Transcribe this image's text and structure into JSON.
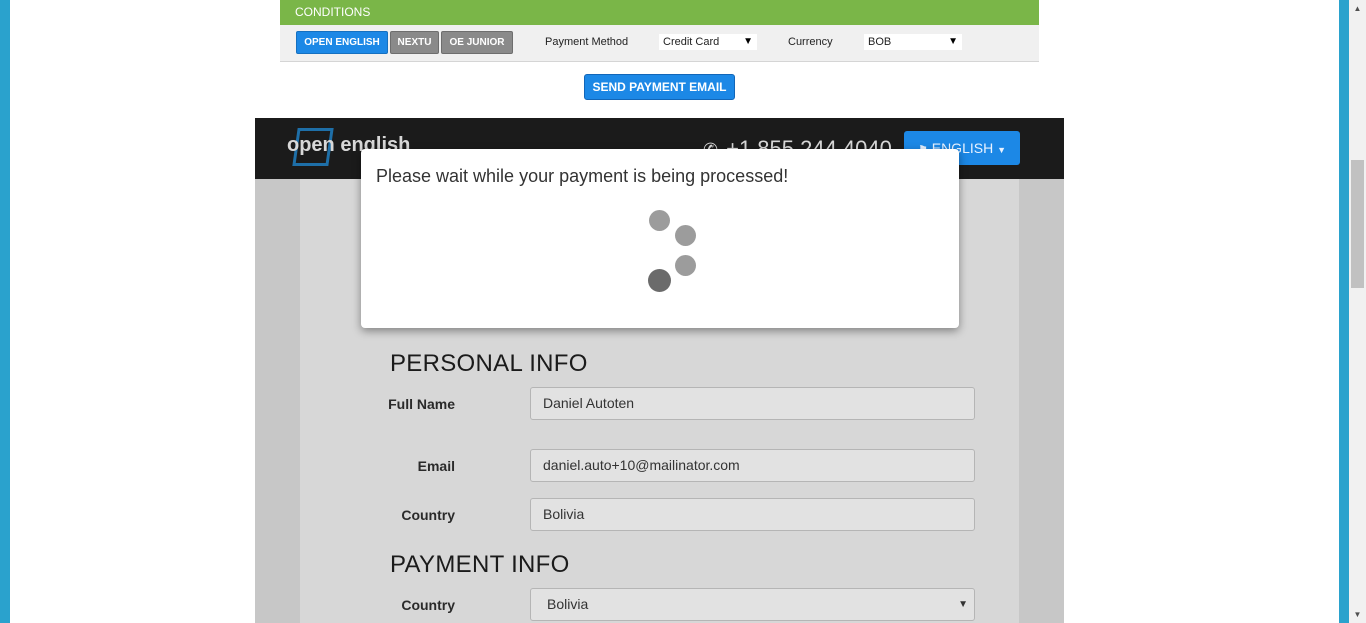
{
  "conditions": {
    "header": "CONDITIONS",
    "brands": [
      {
        "label": "OPEN ENGLISH",
        "active": true
      },
      {
        "label": "NEXTU",
        "active": false
      },
      {
        "label": "OE JUNIOR",
        "active": false
      }
    ],
    "payment_method_label": "Payment Method",
    "payment_method_value": "Credit Card",
    "currency_label": "Currency",
    "currency_value": "BOB"
  },
  "send_payment_email": "SEND PAYMENT EMAIL",
  "embed": {
    "logo": "open english",
    "phone": "+1 855 244 4040",
    "language": "ENGLISH",
    "personal_info": {
      "title": "PERSONAL INFO",
      "full_name_label": "Full Name",
      "full_name_value": "Daniel Autoten",
      "email_label": "Email",
      "email_value": "daniel.auto+10@mailinator.com",
      "country_label": "Country",
      "country_value": "Bolivia"
    },
    "payment_info": {
      "title": "PAYMENT INFO",
      "country_label": "Country",
      "country_value": "Bolivia"
    }
  },
  "modal": {
    "message": "Please wait while your payment is being processed!"
  },
  "colors": {
    "accent_blue": "#1c88e6",
    "conditions_green": "#7ab648",
    "frame_cyan": "#2aa2cd"
  }
}
